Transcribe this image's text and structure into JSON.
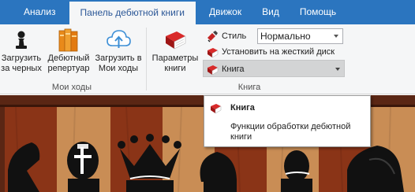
{
  "tabs": [
    {
      "label": "Анализ"
    },
    {
      "label": "Панель дебютной книги"
    },
    {
      "label": "Движок"
    },
    {
      "label": "Вид"
    },
    {
      "label": "Помощь"
    }
  ],
  "ribbon": {
    "moi_hody": {
      "group_label": "Мои ходы",
      "load_black": {
        "line1": "Загрузить",
        "line2": "за черных"
      },
      "repertoire": {
        "line1": "Дебютный",
        "line2": "репертуар"
      },
      "load_mine": {
        "line1": "Загрузить в",
        "line2": "Мои ходы"
      }
    },
    "kniga": {
      "group_label": "Книга",
      "params": {
        "line1": "Параметры",
        "line2": "книги"
      },
      "style_label": "Стиль",
      "style_value": "Нормально",
      "install_label": "Установить на жесткий диск",
      "book_label": "Книга"
    }
  },
  "tooltip": {
    "title": "Книга",
    "text": "Функции обработки дебютной книги"
  },
  "colors": {
    "tabbar": "#2b75bf",
    "ribbon": "#f5f6f7",
    "light_square": "#c98d55",
    "dark_square": "#8a3417"
  },
  "icons": {
    "pawn": "pawn-icon",
    "books": "books-icon",
    "cloud": "cloud-upload-icon",
    "red_book": "red-book-icon",
    "style": "style-brush-icon",
    "install": "install-disk-icon"
  }
}
